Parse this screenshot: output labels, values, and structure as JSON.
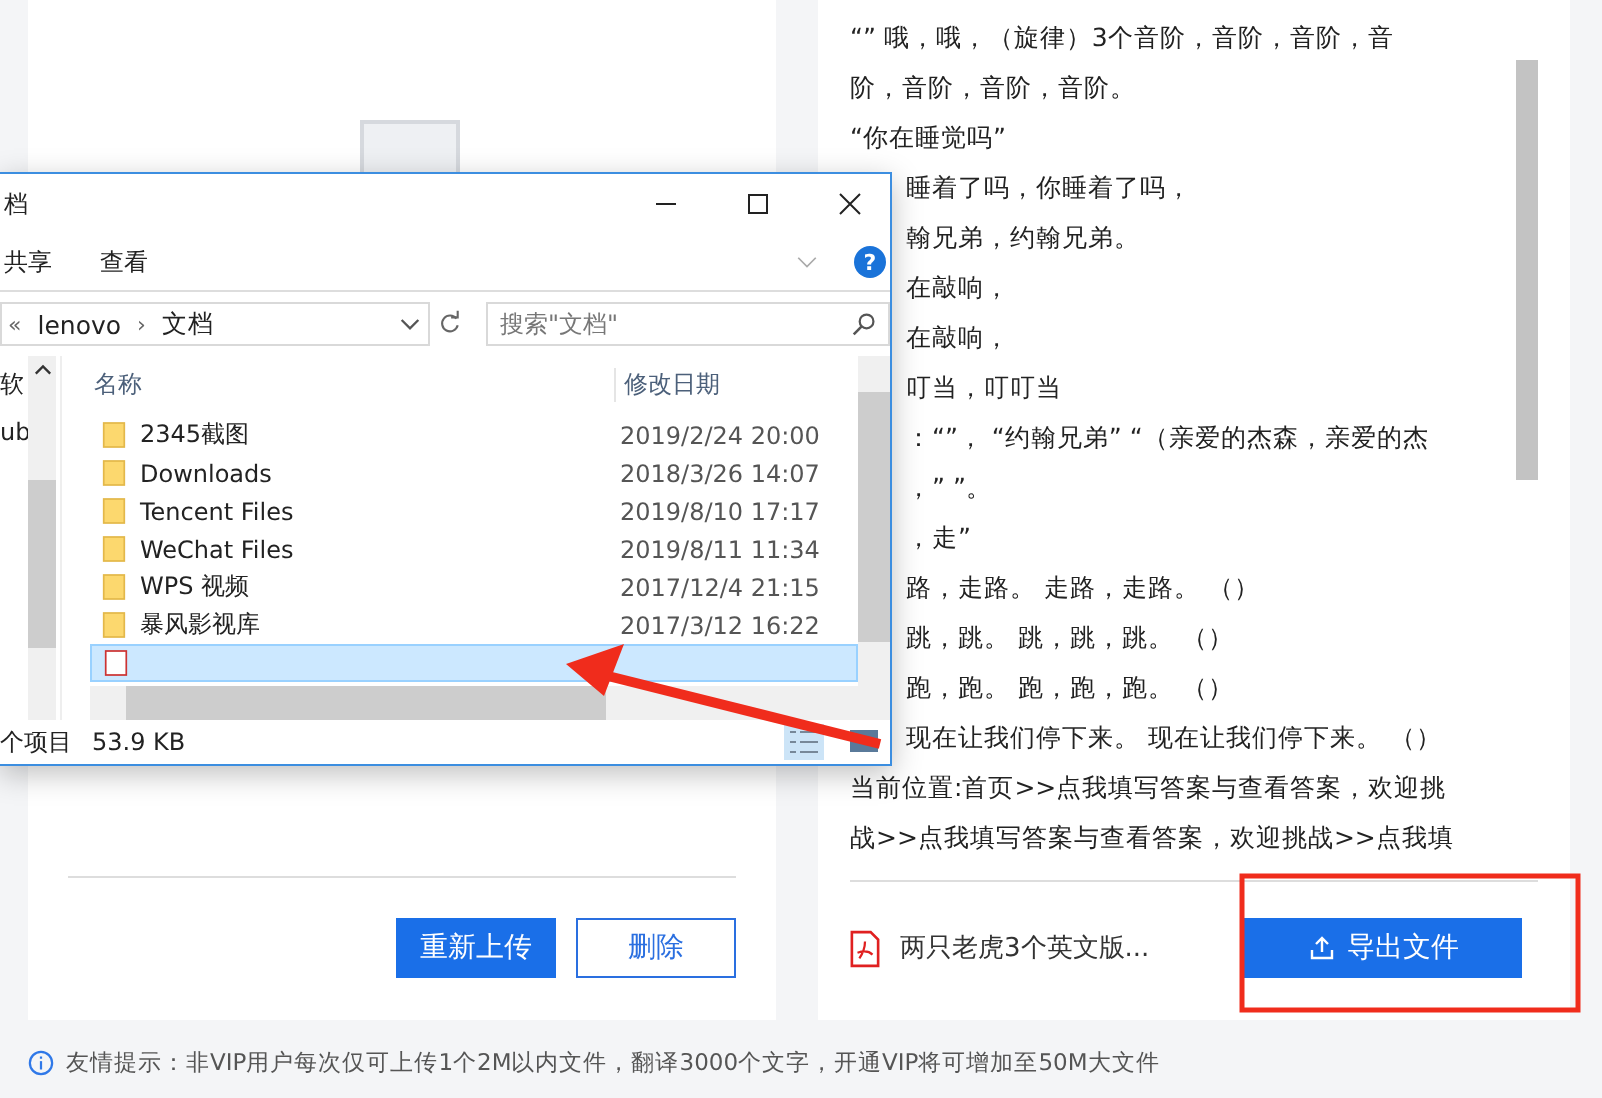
{
  "left_panel": {
    "buttons": [
      {
        "label": "重新上传",
        "kind": "primary"
      },
      {
        "label": "删除",
        "kind": "outline"
      }
    ]
  },
  "right_panel": {
    "lines": [
      "“” 哦，哦，（旋律）3个音阶，音阶，音阶，音",
      "阶，音阶，音阶，音阶。",
      "“你在睡觉吗”",
      "睡着了吗，你睡着了吗，",
      "翰兄弟，约翰兄弟。",
      "在敲响，",
      "在敲响，",
      "叮当，叮叮当",
      "：“”， “约翰兄弟” “（亲爱的杰森，亲爱的杰",
      "，” ”。",
      "，走”",
      "路，走路。 走路，走路。 （）",
      "跳，跳。 跳，跳，跳。 （）",
      "跑，跑。 跑，跑，跑。 （）",
      "现在让我们停下来。 现在让我们停下来。 （）",
      "当前位置:首页>>点我填写答案与查看答案，欢迎挑",
      "战>>点我填写答案与查看答案，欢迎挑战>>点我填"
    ],
    "file_name": "两只老虎3个英文版...",
    "export_button": "导出文件"
  },
  "tip": "友情提示：非VIP用户每次仅可上传1个2M以内文件，翻译3000个文字，开通VIP将可增加至50M大文件",
  "dialog": {
    "title": "档",
    "help_glyph": "?",
    "path_prefix": "«",
    "path_separator": "›",
    "ribbon_tabs": [
      "共享",
      "查看"
    ],
    "path": [
      "lenovo",
      "文档"
    ],
    "search_placeholder": "搜索\"文档\"",
    "nav_items": [
      "软",
      "ub"
    ],
    "columns": [
      "名称",
      "修改日期"
    ],
    "rows": [
      {
        "name": "2345截图",
        "date": "2019/2/24 20:00",
        "kind": "folder",
        "selected": false
      },
      {
        "name": "Downloads",
        "date": "2018/3/26 14:07",
        "kind": "folder",
        "selected": false
      },
      {
        "name": "Tencent Files",
        "date": "2019/8/10 17:17",
        "kind": "folder",
        "selected": false
      },
      {
        "name": "WeChat Files",
        "date": "2019/8/11 11:34",
        "kind": "folder",
        "selected": false
      },
      {
        "name": "WPS 视频",
        "date": "2017/12/4 21:15",
        "kind": "folder",
        "selected": false
      },
      {
        "name": "暴风影视库",
        "date": "2017/3/12 16:22",
        "kind": "folder",
        "selected": false
      },
      {
        "kind": "pdf",
        "selected": true
      }
    ],
    "status": [
      "个项目",
      "53.9 KB"
    ]
  }
}
